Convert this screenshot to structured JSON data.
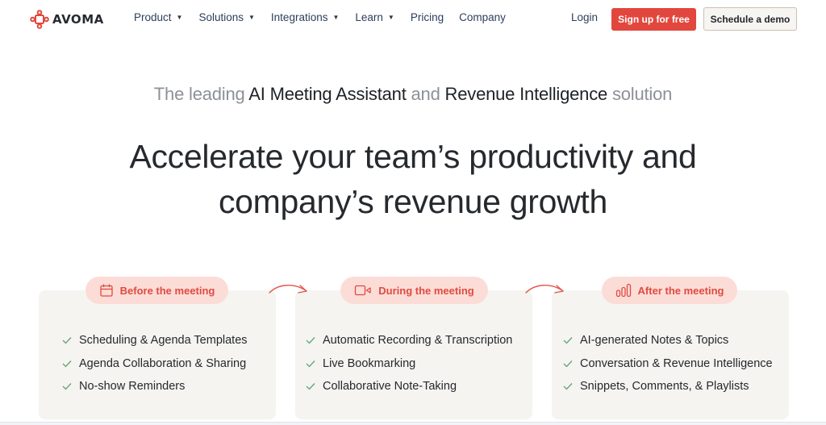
{
  "brand": {
    "name": "AVOMA",
    "accent": "#e2473e",
    "pill_bg": "#fcdcd7",
    "card_bg": "#f5f4f1",
    "check_color": "#5fa472"
  },
  "nav": {
    "items": [
      {
        "label": "Product",
        "dropdown": true
      },
      {
        "label": "Solutions",
        "dropdown": true
      },
      {
        "label": "Integrations",
        "dropdown": true
      },
      {
        "label": "Learn",
        "dropdown": true
      },
      {
        "label": "Pricing",
        "dropdown": false
      },
      {
        "label": "Company",
        "dropdown": false
      }
    ],
    "caret": "▼",
    "login": "Login",
    "signup": "Sign up for free",
    "demo": "Schedule a demo"
  },
  "hero": {
    "tagline": {
      "part1": "The leading ",
      "part2": "AI Meeting Assistant",
      "part3": " and ",
      "part4": "Revenue Intelligence",
      "part5": " solution"
    },
    "headline_line1": "Accelerate your team’s productivity and",
    "headline_line2": "company’s revenue growth"
  },
  "stages": [
    {
      "label": "Before the meeting",
      "icon": "calendar-icon",
      "features": [
        "Scheduling & Agenda Templates",
        "Agenda Collaboration & Sharing",
        "No-show Reminders"
      ]
    },
    {
      "label": "During the meeting",
      "icon": "video-camera-icon",
      "features": [
        "Automatic Recording & Transcription",
        "Live Bookmarking",
        "Collaborative Note-Taking"
      ]
    },
    {
      "label": "After the meeting",
      "icon": "bar-chart-icon",
      "features": [
        "AI-generated Notes & Topics",
        "Conversation & Revenue Intelligence",
        "Snippets, Comments, & Playlists"
      ]
    }
  ]
}
